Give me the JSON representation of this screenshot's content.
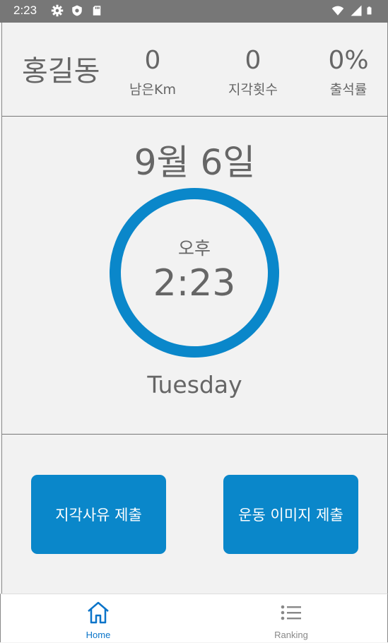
{
  "status_bar": {
    "time": "2:23",
    "left_icons": [
      "settings-gear-icon",
      "shield-icon",
      "sd-card-icon"
    ],
    "right_icons": [
      "wifi-icon",
      "cellular-signal-icon",
      "battery-icon"
    ]
  },
  "header": {
    "user_name": "홍길동",
    "stats": [
      {
        "value": "0",
        "label": "남은Km"
      },
      {
        "value": "0",
        "label": "지각횟수"
      },
      {
        "value": "0%",
        "label": "출석률"
      }
    ]
  },
  "main": {
    "date": "9월 6일",
    "ampm": "오후",
    "time": "2:23",
    "weekday": "Tuesday"
  },
  "actions": {
    "late_reason_label": "지각사유 제출",
    "exercise_image_label": "운동 이미지 제출"
  },
  "bottom_nav": {
    "items": [
      {
        "label": "Home",
        "icon": "home-icon",
        "active": true
      },
      {
        "label": "Ranking",
        "icon": "list-icon",
        "active": false
      }
    ]
  },
  "colors": {
    "accent": "#0a87ca",
    "status_bar": "#777777",
    "text": "#666666",
    "background": "#f2f2f2"
  }
}
